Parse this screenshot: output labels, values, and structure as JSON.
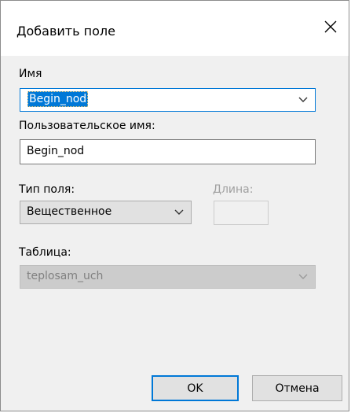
{
  "dialog": {
    "title": "Добавить поле",
    "close_icon": "close-icon"
  },
  "fields": {
    "name": {
      "label": "Имя",
      "value": "Begin_nod"
    },
    "user_name": {
      "label": "Пользовательское имя:",
      "value": "Begin_nod"
    },
    "field_type": {
      "label": "Тип поля:",
      "value": "Вещественное"
    },
    "length": {
      "label": "Длина:",
      "value": ""
    },
    "table": {
      "label": "Таблица:",
      "value": "teplosam_uch"
    }
  },
  "buttons": {
    "ok": "OK",
    "cancel": "Отмена"
  },
  "colors": {
    "accent": "#0078d7",
    "disabled_text": "#a0a0a0",
    "dialog_bg": "#f0f0f0"
  }
}
